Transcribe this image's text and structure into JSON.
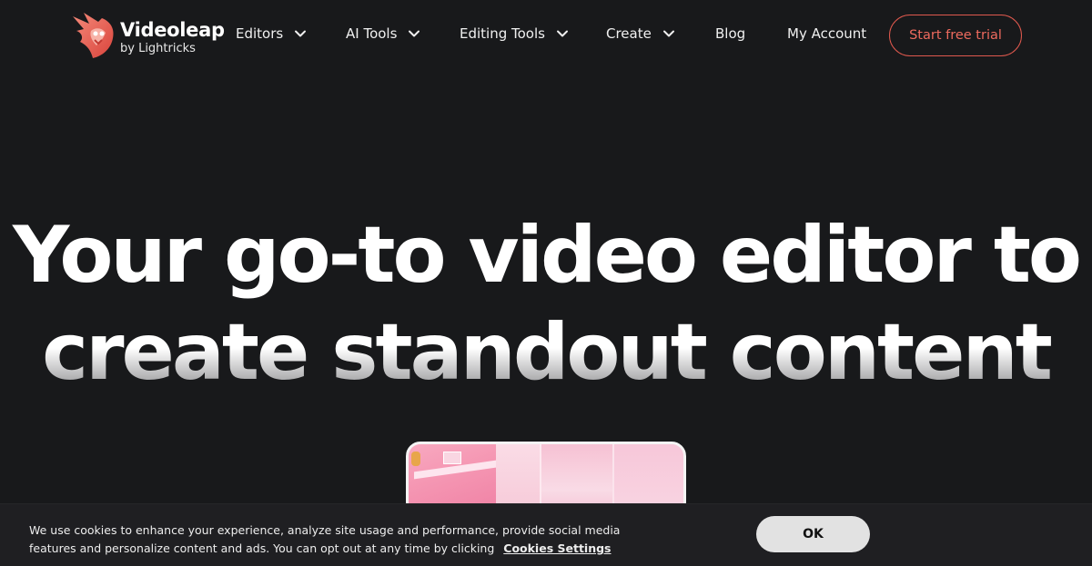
{
  "brand": {
    "name": "Videoleap",
    "byline": "by Lightricks",
    "accent_color": "#e0594e"
  },
  "nav": {
    "items": [
      {
        "label": "Editors",
        "has_dropdown": true
      },
      {
        "label": "AI Tools",
        "has_dropdown": true
      },
      {
        "label": "Editing Tools",
        "has_dropdown": true
      },
      {
        "label": "Create",
        "has_dropdown": true
      },
      {
        "label": "Blog",
        "has_dropdown": false
      },
      {
        "label": "My Account",
        "has_dropdown": false
      }
    ],
    "cta_label": "Start free trial"
  },
  "hero": {
    "line1": "Your go-to video editor to",
    "line2": "create standout content"
  },
  "cookie_banner": {
    "text": "We use cookies to enhance your experience, analyze site usage and performance, provide social media features and personalize content and ads. You can opt out at any time by clicking",
    "link_label": "Cookies Settings",
    "ok_label": "OK"
  }
}
